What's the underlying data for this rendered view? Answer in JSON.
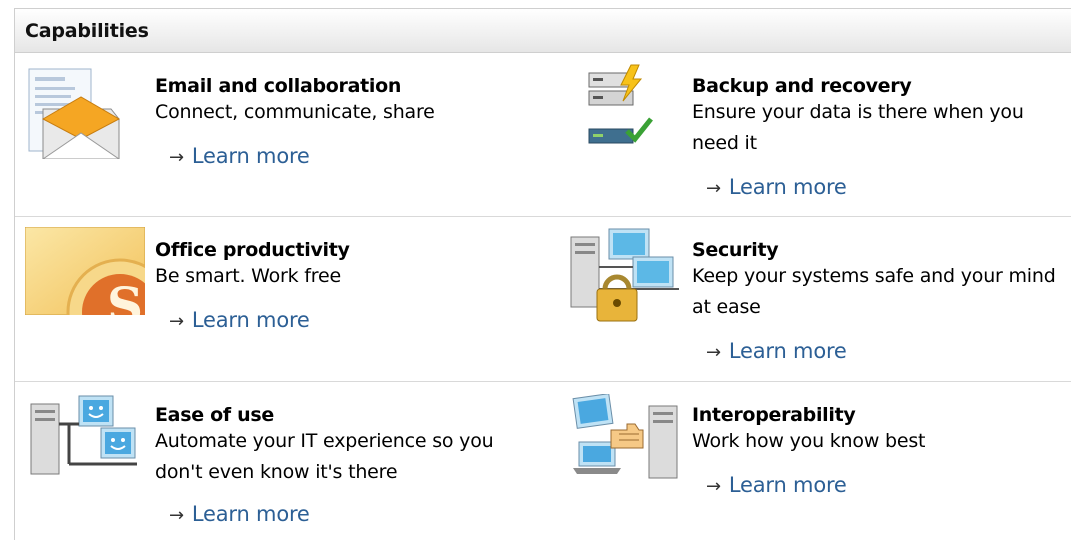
{
  "header": {
    "title": "Capabilities"
  },
  "items": [
    {
      "title": "Email and collaboration",
      "description": "Connect, communicate, share",
      "link": "Learn more",
      "icon": "email-envelope-icon"
    },
    {
      "title": "Backup and recovery",
      "description": "Ensure your data is there when you need it",
      "link": "Learn more",
      "icon": "backup-server-icon"
    },
    {
      "title": "Office productivity",
      "description": "Be smart. Work free",
      "link": "Learn more",
      "icon": "office-logo-icon"
    },
    {
      "title": "Security",
      "description": "Keep your systems safe and your mind at ease",
      "link": "Learn more",
      "icon": "security-lock-icon"
    },
    {
      "title": "Ease of use",
      "description": "Automate your IT experience so you don't even know it's there",
      "link": "Learn more",
      "icon": "network-computers-icon"
    },
    {
      "title": "Interoperability",
      "description": "Work how you know best",
      "link": "Learn more",
      "icon": "interoperability-icon"
    }
  ],
  "link_arrow": "→",
  "colors": {
    "link": "#2c5f95",
    "header_bg": "#e6e6e6",
    "divider": "#d9d9d9"
  }
}
